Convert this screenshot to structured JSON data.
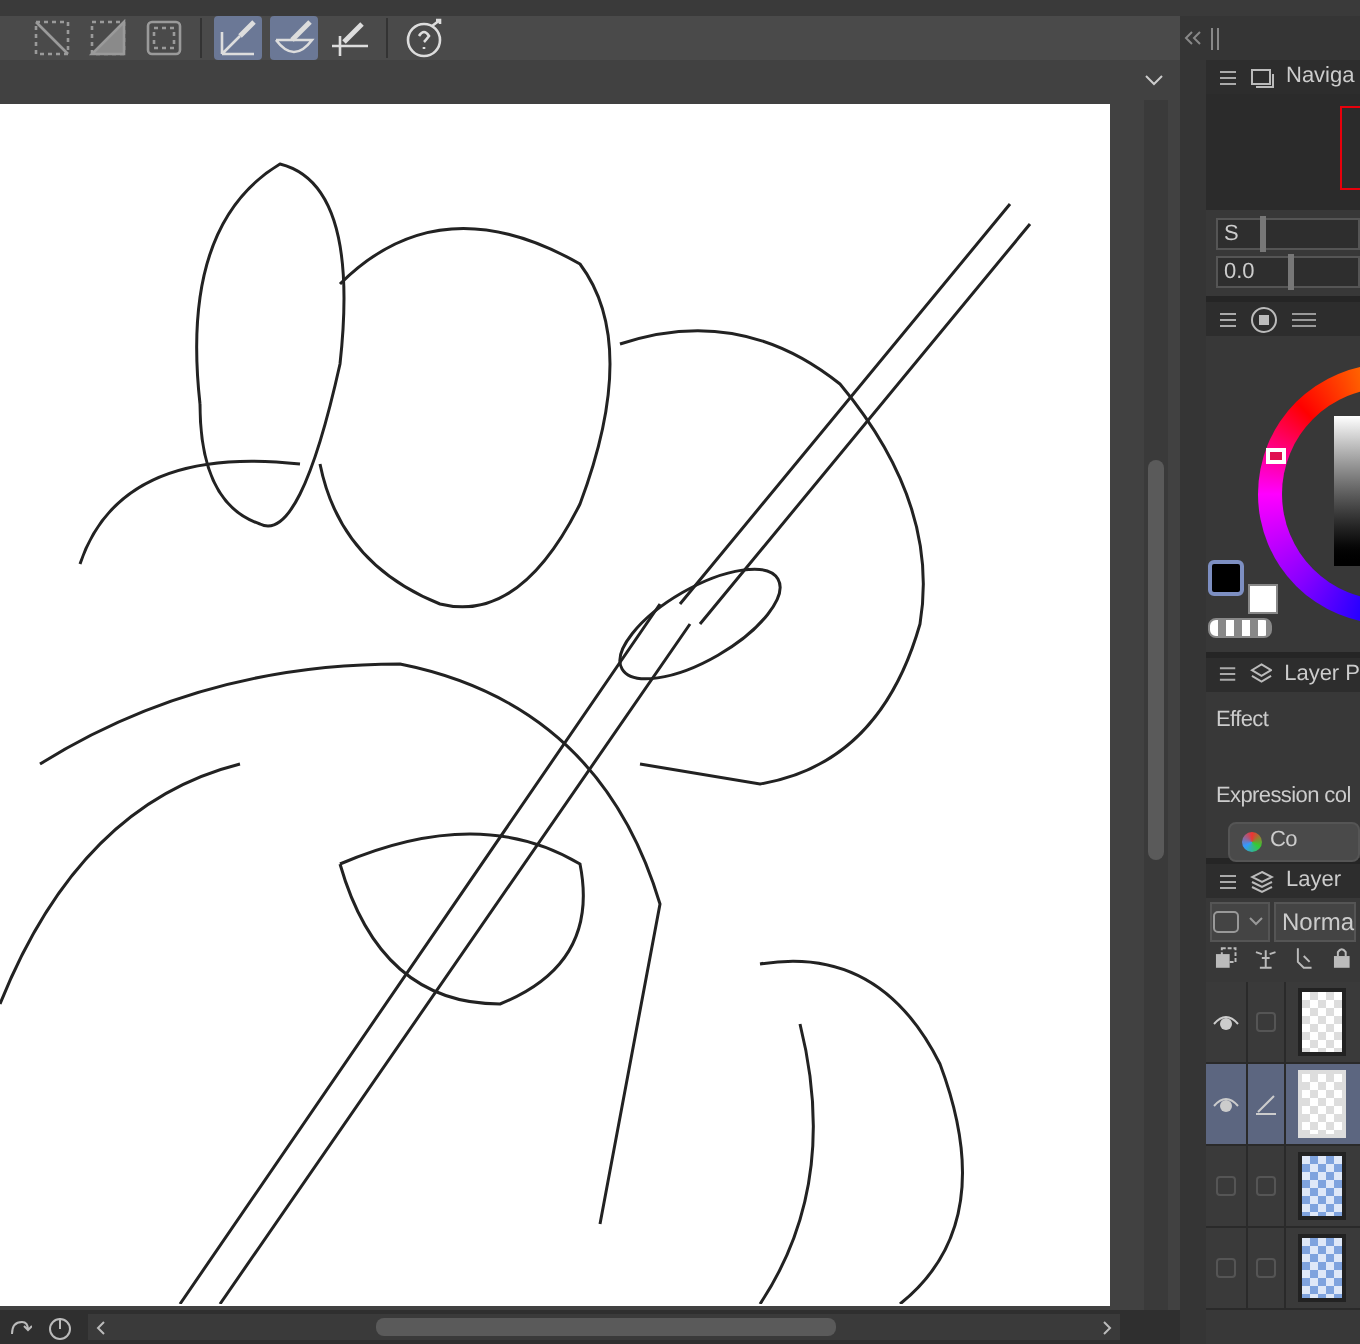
{
  "toolbar": {
    "tools": [
      {
        "kind": "clear",
        "selected": false
      },
      {
        "kind": "fill",
        "selected": false
      },
      {
        "kind": "frame",
        "selected": false
      },
      {
        "kind": "ruler",
        "selected": true
      },
      {
        "kind": "curve",
        "selected": true
      },
      {
        "kind": "snap",
        "selected": false
      },
      {
        "kind": "help",
        "selected": false
      }
    ]
  },
  "navigator": {
    "tab": "Naviga",
    "zoom": {
      "reading": "S",
      "level": 0.3
    },
    "rotate": {
      "reading": "0.0",
      "level": 0.5
    }
  },
  "layer_property": {
    "tab": "Layer P",
    "effect_label": "Effect",
    "expression_label": "Expression col",
    "color_button": "Co"
  },
  "layer_panel": {
    "tab": "Layer",
    "blend_mode": "Norma",
    "layers": [
      {
        "visible": true,
        "editing": false,
        "selected": false,
        "blue": false
      },
      {
        "visible": true,
        "editing": true,
        "selected": true,
        "blue": false
      },
      {
        "visible": false,
        "editing": false,
        "selected": false,
        "blue": true
      },
      {
        "visible": false,
        "editing": false,
        "selected": false,
        "blue": true
      }
    ]
  }
}
